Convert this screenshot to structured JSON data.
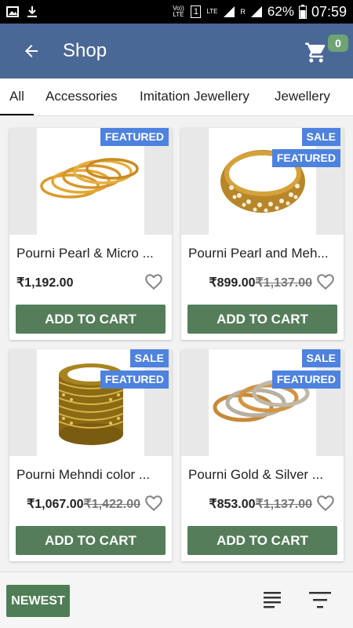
{
  "status_bar": {
    "volte": "Vo)) LTE",
    "sim": "1",
    "network": "LTE",
    "roaming": "R",
    "battery": "62%",
    "time": "07:59"
  },
  "app_bar": {
    "title": "Shop",
    "cart_count": "0"
  },
  "tabs": [
    {
      "label": "All",
      "active": true
    },
    {
      "label": "Accessories",
      "active": false
    },
    {
      "label": "Imitation Jewellery",
      "active": false
    },
    {
      "label": "Jewellery",
      "active": false
    }
  ],
  "products": [
    {
      "name": "Pourni Pearl & Micro ...",
      "price": "₹1,192.00",
      "old_price": "",
      "badges": [
        "FEATURED"
      ],
      "add_label": "ADD TO CART",
      "image": "gold-bangles-thin-icon"
    },
    {
      "name": "Pourni Pearl and Meh...",
      "price": "₹899.00",
      "old_price": "₹1,137.00",
      "badges": [
        "SALE",
        "FEATURED"
      ],
      "add_label": "ADD TO CART",
      "image": "pearl-bangle-stack-icon"
    },
    {
      "name": "Pourni Mehndi color ...",
      "price": "₹1,067.00",
      "old_price": "₹1,422.00",
      "badges": [
        "SALE",
        "FEATURED"
      ],
      "add_label": "ADD TO CART",
      "image": "mehndi-bangle-stack-icon"
    },
    {
      "name": "Pourni Gold & Silver ...",
      "price": "₹853.00",
      "old_price": "₹1,137.00",
      "badges": [
        "SALE",
        "FEATURED"
      ],
      "add_label": "ADD TO CART",
      "image": "gold-silver-bangles-icon"
    }
  ],
  "bottom_bar": {
    "newest_label": "NEWEST"
  },
  "colors": {
    "app_bar": "#4a6896",
    "badge": "#4d82de",
    "button": "#557d5a",
    "cart_badge": "#6fa374"
  }
}
